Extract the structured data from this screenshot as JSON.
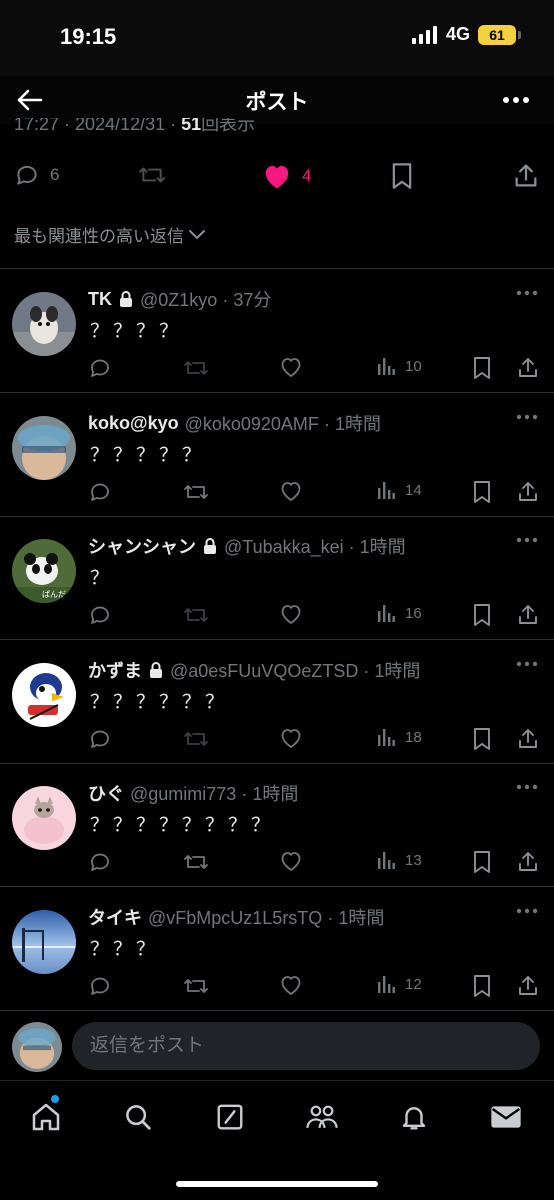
{
  "status_bar": {
    "time": "19:15",
    "network": "4G",
    "battery": "61"
  },
  "header": {
    "title": "ポスト"
  },
  "post_meta": {
    "time": "17:27",
    "date": "2024/12/31",
    "views": "51",
    "views_label": "回表示"
  },
  "post_actions": {
    "replies": "6",
    "likes": "4"
  },
  "sort_label": "最も関連性の高い返信",
  "replies": [
    {
      "name": "TK",
      "locked": true,
      "handle": "@0Z1kyo",
      "time": "37分",
      "text": "？？？？",
      "views": "10",
      "retweet_enabled": false
    },
    {
      "name": "koko@kyo",
      "locked": false,
      "handle": "@koko0920AMF",
      "time": "1時間",
      "text": "？？？？？",
      "views": "14",
      "retweet_enabled": true
    },
    {
      "name": "シャンシャン",
      "locked": true,
      "handle": "@Tubakka_kei",
      "time": "1時間",
      "text": "？",
      "views": "16",
      "retweet_enabled": false
    },
    {
      "name": "かずま",
      "locked": true,
      "handle": "@a0esFUuVQOeZTSD",
      "time": "1時間",
      "text": "？？？？？？",
      "views": "18",
      "retweet_enabled": false
    },
    {
      "name": "ひぐ",
      "locked": false,
      "handle": "@gumimi773",
      "time": "1時間",
      "text": "？？？？？？？？",
      "views": "13",
      "retweet_enabled": true
    },
    {
      "name": "タイキ",
      "locked": false,
      "handle": "@vFbMpcUz1L5rsTQ",
      "time": "1時間",
      "text": "？？？",
      "views": "12",
      "retweet_enabled": true
    }
  ],
  "reply_input": {
    "placeholder": "返信をポスト"
  },
  "tab_bar": [
    "home-icon",
    "search-icon",
    "grok-icon",
    "communities-icon",
    "notifications-icon",
    "messages-icon"
  ],
  "colors": {
    "like": "#f91880",
    "text": "#e7e9ea",
    "muted": "#71767b",
    "accent": "#1d9bf0"
  }
}
